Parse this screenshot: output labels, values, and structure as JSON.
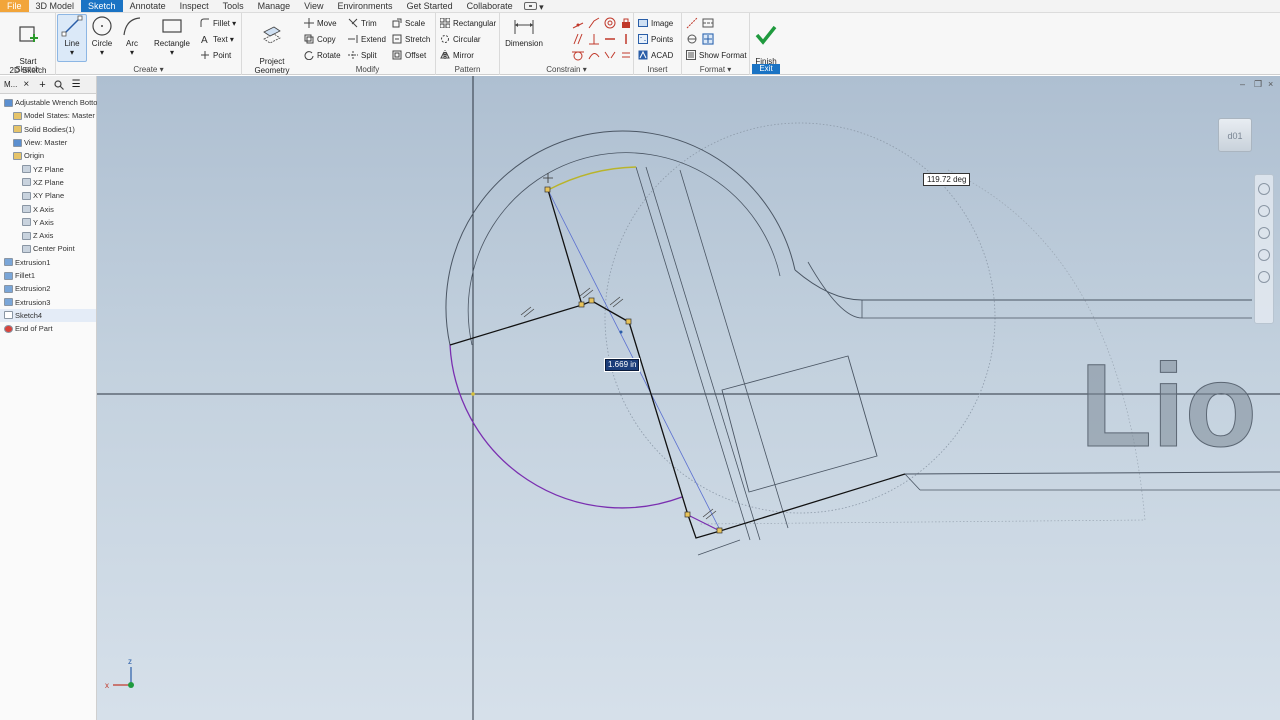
{
  "menu": {
    "items": [
      "File",
      "3D Model",
      "Sketch",
      "Annotate",
      "Inspect",
      "Tools",
      "Manage",
      "View",
      "Environments",
      "Get Started",
      "Collaborate"
    ],
    "active": "Sketch"
  },
  "ribbon": {
    "start_sketch": "Start\n2D Sketch",
    "sketch_panel": "Sketch",
    "line": "Line",
    "circle": "Circle",
    "arc": "Arc",
    "rectangle": "Rectangle",
    "fillet": "Fillet",
    "text": "Text",
    "point": "Point",
    "create_panel": "Create",
    "project_geometry": "Project\nGeometry",
    "move": "Move",
    "copy": "Copy",
    "rotate": "Rotate",
    "trim": "Trim",
    "extend": "Extend",
    "split": "Split",
    "scale": "Scale",
    "stretch": "Stretch",
    "offset": "Offset",
    "modify_panel": "Modify",
    "rectangular": "Rectangular",
    "circular": "Circular",
    "mirror": "Mirror",
    "pattern_panel": "Pattern",
    "dimension": "Dimension",
    "constrain_panel": "Constrain",
    "image": "Image",
    "points": "Points",
    "acad": "ACAD",
    "insert_panel": "Insert",
    "show_format": "Show Format",
    "format_panel": "Format",
    "finish_sketch": "Finish\nSketch",
    "exit_panel": "Exit"
  },
  "browser": {
    "tab": "M...",
    "items": [
      {
        "label": "Adjustable Wrench Bottom",
        "indent": 0,
        "icon": "part-icon"
      },
      {
        "label": "Model States: Master",
        "indent": 1,
        "icon": "folder-icon"
      },
      {
        "label": "Solid Bodies(1)",
        "indent": 1,
        "icon": "folder-icon"
      },
      {
        "label": "View: Master",
        "indent": 1,
        "icon": "view-icon"
      },
      {
        "label": "Origin",
        "indent": 1,
        "icon": "folder-icon"
      },
      {
        "label": "YZ Plane",
        "indent": 2,
        "icon": "plane-icon"
      },
      {
        "label": "XZ Plane",
        "indent": 2,
        "icon": "plane-icon"
      },
      {
        "label": "XY Plane",
        "indent": 2,
        "icon": "plane-icon"
      },
      {
        "label": "X Axis",
        "indent": 2,
        "icon": "axis-icon"
      },
      {
        "label": "Y Axis",
        "indent": 2,
        "icon": "axis-icon"
      },
      {
        "label": "Z Axis",
        "indent": 2,
        "icon": "axis-icon"
      },
      {
        "label": "Center Point",
        "indent": 2,
        "icon": "point-icon"
      },
      {
        "label": "Extrusion1",
        "indent": 0,
        "icon": "extrusion-icon"
      },
      {
        "label": "Fillet1",
        "indent": 0,
        "icon": "fillet-icon"
      },
      {
        "label": "Extrusion2",
        "indent": 0,
        "icon": "extrusion-icon"
      },
      {
        "label": "Extrusion3",
        "indent": 0,
        "icon": "extrusion-icon"
      },
      {
        "label": "Sketch4",
        "indent": 0,
        "icon": "sketch-icon"
      },
      {
        "label": "End of Part",
        "indent": 0,
        "icon": "end-of-part-icon"
      }
    ]
  },
  "canvas": {
    "angle_dim": "119.72 deg",
    "length_dim": "1.669 in",
    "embossed_text": "Lio",
    "viewcube_label": "d01"
  }
}
